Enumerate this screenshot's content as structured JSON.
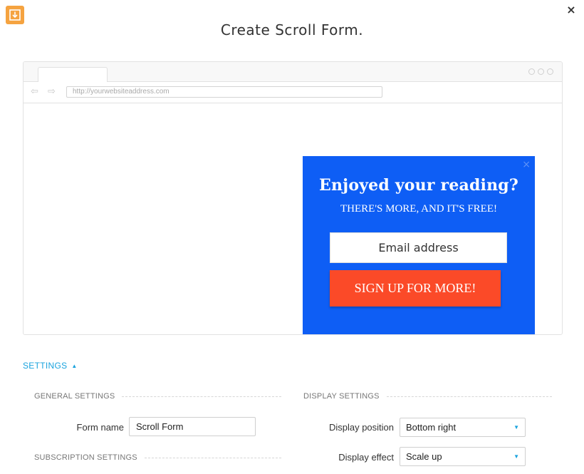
{
  "header": {
    "title": "Create Scroll Form.",
    "close_glyph": "×",
    "app_icon": "download-icon",
    "app_icon_color": "#f5a340"
  },
  "browser_preview": {
    "url_placeholder": "http://yourwebsiteaddress.com",
    "back_glyph": "⇦",
    "forward_glyph": "⇨"
  },
  "popup": {
    "heading": "Enjoyed your reading?",
    "subheading": "THERE'S MORE, AND IT'S FREE!",
    "email_placeholder": "Email address",
    "button_label": "SIGN UP FOR MORE!",
    "close_glyph": "×",
    "background_color": "#0e5ef5",
    "button_color": "#fb4a28"
  },
  "settings": {
    "toggle_label": "SETTINGS",
    "toggle_caret": "▲",
    "accent_color": "#1aa3de",
    "general": {
      "title": "GENERAL SETTINGS",
      "form_name_label": "Form name",
      "form_name_value": "Scroll Form"
    },
    "subscription": {
      "title": "SUBSCRIPTION SETTINGS"
    },
    "display": {
      "title": "DISPLAY SETTINGS",
      "position_label": "Display position",
      "position_value": "Bottom right",
      "effect_label": "Display effect",
      "effect_value": "Scale up",
      "select_caret": "▼"
    }
  }
}
